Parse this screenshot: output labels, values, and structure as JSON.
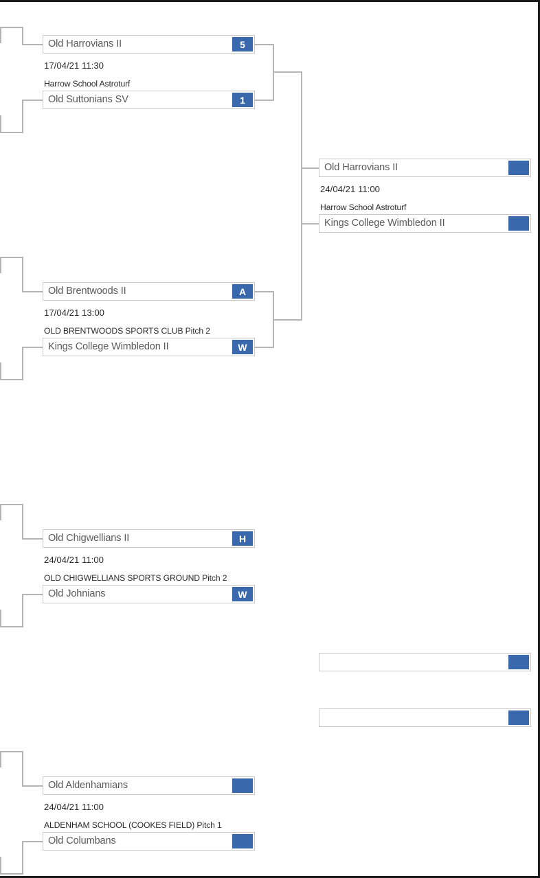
{
  "bracket": {
    "accent_color": "#3a68ad",
    "line_color": "#b4b4b4",
    "box_border_color": "#c9c9c9",
    "text_color": "#59595b",
    "rounds": [
      {
        "name": "round-1",
        "matches": [
          {
            "id": "r1-m1",
            "date": "17/04/21 11:30",
            "venue": "Harrow School Astroturf",
            "top": {
              "team": "Old Harrovians II",
              "score": "5"
            },
            "bottom": {
              "team": "Old Suttonians SV",
              "score": "1"
            }
          },
          {
            "id": "r1-m2",
            "date": "17/04/21 13:00",
            "venue": "OLD BRENTWOODS SPORTS CLUB Pitch 2",
            "top": {
              "team": "Old Brentwoods II",
              "score": "A"
            },
            "bottom": {
              "team": "Kings College Wimbledon II",
              "score": "W"
            }
          },
          {
            "id": "r1-m3",
            "date": "24/04/21 11:00",
            "venue": "OLD CHIGWELLIANS SPORTS GROUND Pitch 2",
            "top": {
              "team": "Old Chigwellians II",
              "score": "H"
            },
            "bottom": {
              "team": "Old Johnians",
              "score": "W"
            }
          },
          {
            "id": "r1-m4",
            "date": "24/04/21 11:00",
            "venue": "ALDENHAM SCHOOL (COOKES FIELD) Pitch 1",
            "top": {
              "team": "Old Aldenhamians",
              "score": ""
            },
            "bottom": {
              "team": "Old Columbans",
              "score": ""
            }
          }
        ]
      },
      {
        "name": "round-2",
        "matches": [
          {
            "id": "r2-m1",
            "date": "24/04/21 11:00",
            "venue": "Harrow School Astroturf",
            "top": {
              "team": "Old Harrovians II",
              "score": ""
            },
            "bottom": {
              "team": "Kings College Wimbledon II",
              "score": ""
            }
          },
          {
            "id": "r2-m2",
            "date": "",
            "venue": "",
            "top": {
              "team": "",
              "score": ""
            },
            "bottom": {
              "team": "",
              "score": ""
            }
          }
        ]
      }
    ]
  }
}
